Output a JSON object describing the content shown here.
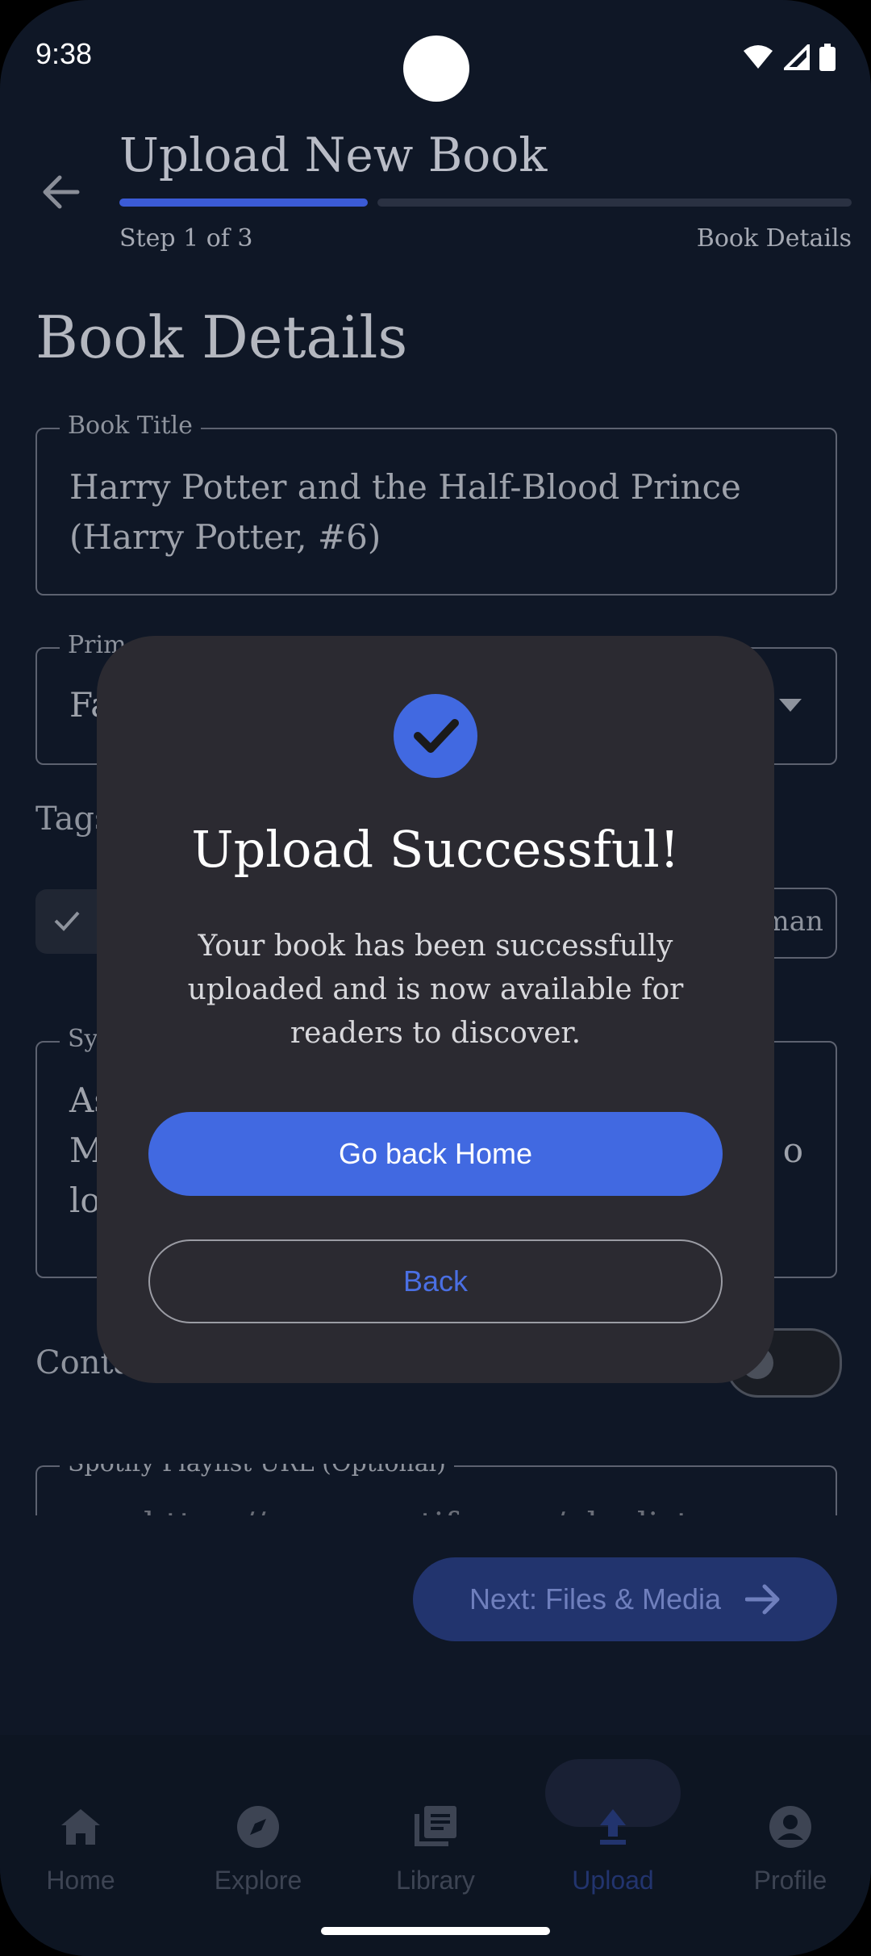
{
  "status_bar": {
    "time": "9:38"
  },
  "header": {
    "title": "Upload New Book",
    "step_label": "Step 1 of 3",
    "step_name": "Book Details",
    "progress_fraction": 0.33
  },
  "form": {
    "section_title": "Book Details",
    "book_title_label": "Book Title",
    "book_title_value_line1": "Harry Potter and the Half-Blood Prince",
    "book_title_value_line2": "(Harry Potter, #6)",
    "genre_label_partial": "Prim",
    "genre_value_partial": "Fa",
    "tags_label_partial": "Tags",
    "tag_chip_partial": "oman",
    "synopsis_label_partial": "Sy",
    "synopsis_line1_partial": "As",
    "synopsis_line2_partial": "M",
    "synopsis_line2_end": "o",
    "synopsis_line3_partial": "lo",
    "content_toggle_label_partial": "Conta",
    "spotify_label": "Spotify Playlist URL (Optional)",
    "spotify_placeholder_partial": "e.g. https://open.spotify.com/playlist...",
    "next_button": "Next: Files & Media"
  },
  "bottom_nav": {
    "items": [
      {
        "label": "Home",
        "icon": "home-icon"
      },
      {
        "label": "Explore",
        "icon": "compass-icon"
      },
      {
        "label": "Library",
        "icon": "library-icon"
      },
      {
        "label": "Upload",
        "icon": "upload-icon",
        "active": true
      },
      {
        "label": "Profile",
        "icon": "profile-icon"
      }
    ]
  },
  "dialog": {
    "title": "Upload Successful!",
    "message": "Your book has been successfully uploaded and is now available for readers to discover.",
    "primary_button": "Go back Home",
    "secondary_button": "Back"
  },
  "colors": {
    "accent": "#4169E1",
    "background": "#0F1726",
    "dialog_background": "#2B2A31"
  }
}
